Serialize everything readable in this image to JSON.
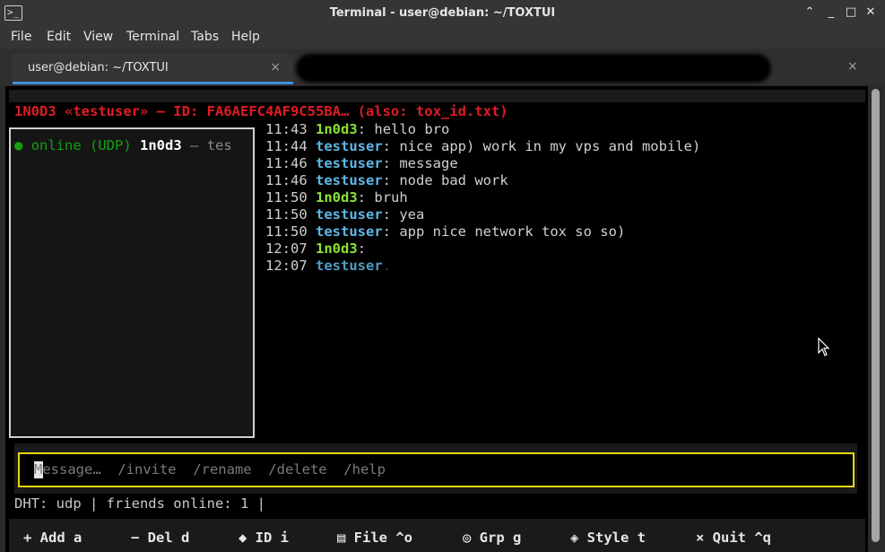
{
  "window": {
    "title": "Terminal - user@debian: ~/TOXTUI",
    "icon": "terminal-icon"
  },
  "menu": [
    "File",
    "Edit",
    "View",
    "Terminal",
    "Tabs",
    "Help"
  ],
  "tabs": [
    {
      "label": "user@debian: ~/TOXTUI",
      "close": "×",
      "active": true
    },
    {
      "label": "",
      "close": "×",
      "active": false
    }
  ],
  "app": {
    "header": "1N0D3 «testuser» — ID: FA6AEFC4AF9C55BA… (also: tox_id.txt)",
    "contact": {
      "dot": "●",
      "status": "online (UDP)",
      "name": "1n0d3",
      "rest": "— tes"
    },
    "messages": [
      {
        "time": "11:43",
        "sender": "1n0d3",
        "text": "hello bro",
        "kind": "n1"
      },
      {
        "time": "11:44",
        "sender": "testuser",
        "text": "nice app) work in my vps and mobile)",
        "kind": "n2"
      },
      {
        "time": "11:46",
        "sender": "testuser",
        "text": "message",
        "kind": "n2"
      },
      {
        "time": "11:46",
        "sender": "testuser",
        "text": "node bad work",
        "kind": "n2"
      },
      {
        "time": "11:50",
        "sender": "1n0d3",
        "text": "bruh",
        "kind": "n1"
      },
      {
        "time": "11:50",
        "sender": "testuser",
        "text": "yea",
        "kind": "n2"
      },
      {
        "time": "11:50",
        "sender": "testuser",
        "text": "app nice network tox so so)",
        "kind": "n2"
      },
      {
        "time": "12:07",
        "sender": "1n0d3",
        "text": "",
        "kind": "n1"
      },
      {
        "time": "12:07",
        "sender": "testuser",
        "text": "",
        "kind": "n2"
      }
    ],
    "input_placeholder": "Message…  /invite  /rename  /delete  /help",
    "status": "DHT: udp | friends online: 1 |",
    "keys": [
      {
        "label": "+ Add a"
      },
      {
        "label": "− Del d"
      },
      {
        "label": "◆ ID i"
      },
      {
        "label": "▤ File ^o"
      },
      {
        "label": "◎ Grp g"
      },
      {
        "label": "◈ Style t"
      },
      {
        "label": "× Quit ^q"
      }
    ]
  }
}
